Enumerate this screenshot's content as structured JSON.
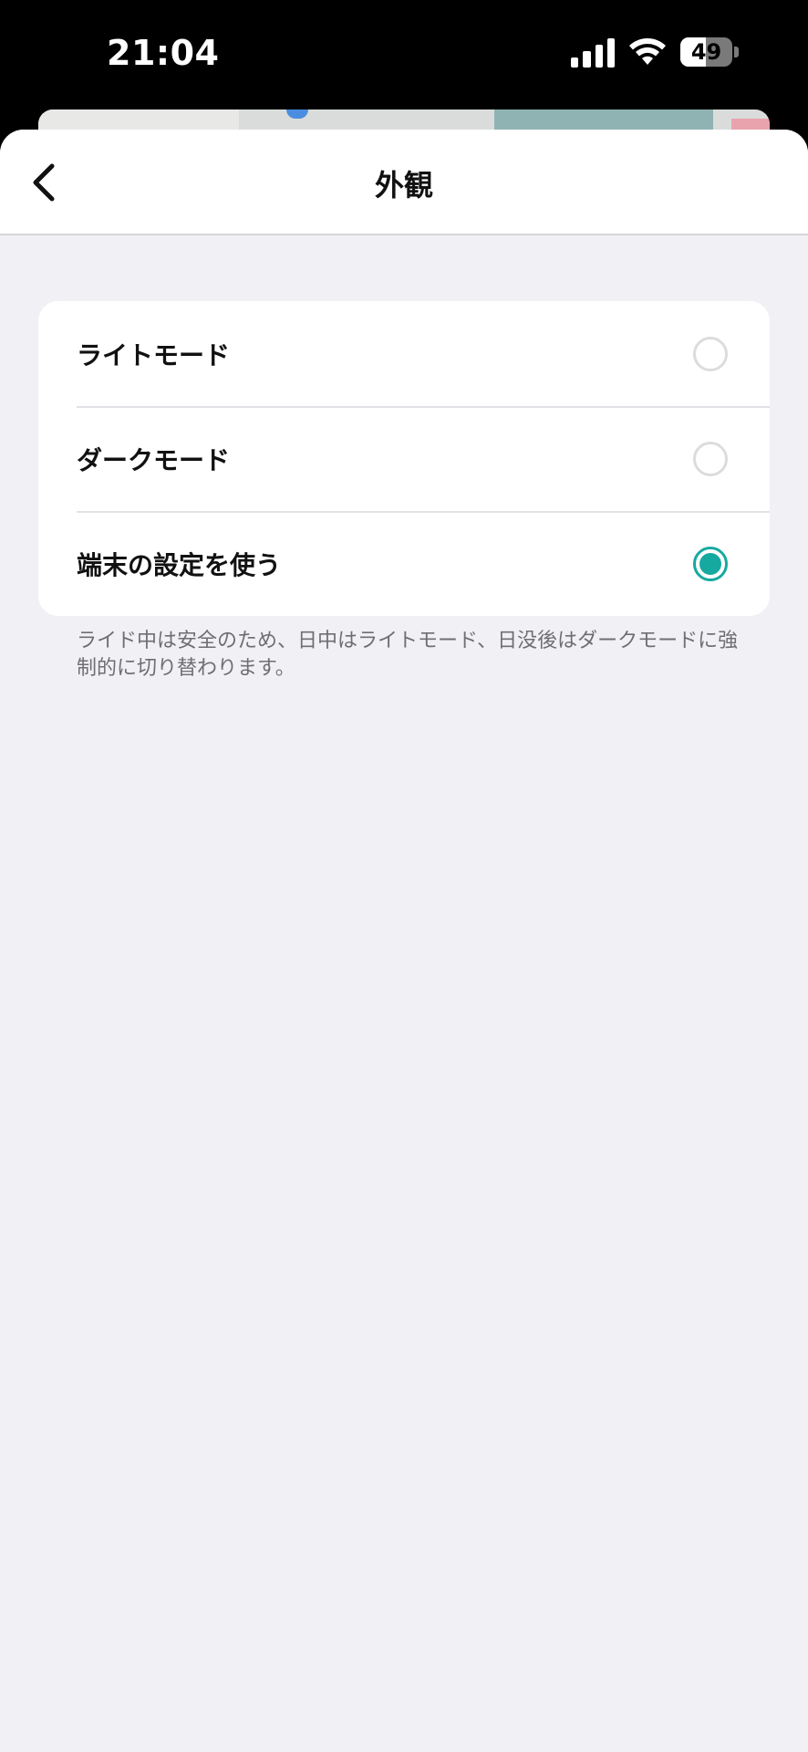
{
  "status_bar": {
    "time": "21:04",
    "battery_level": "49",
    "battery_fraction": 0.49
  },
  "nav": {
    "title": "外観",
    "back_icon": "chevron-left-icon"
  },
  "options": [
    {
      "label": "ライトモード",
      "selected": false
    },
    {
      "label": "ダークモード",
      "selected": false
    },
    {
      "label": "端末の設定を使う",
      "selected": true
    }
  ],
  "footnote": "ライド中は安全のため、日中はライトモード、日没後はダークモードに強制的に切り替わります。",
  "colors": {
    "accent": "#16a9a0",
    "background": "#f1f1f5",
    "card": "#ffffff",
    "secondary_text": "#6e6e73"
  }
}
